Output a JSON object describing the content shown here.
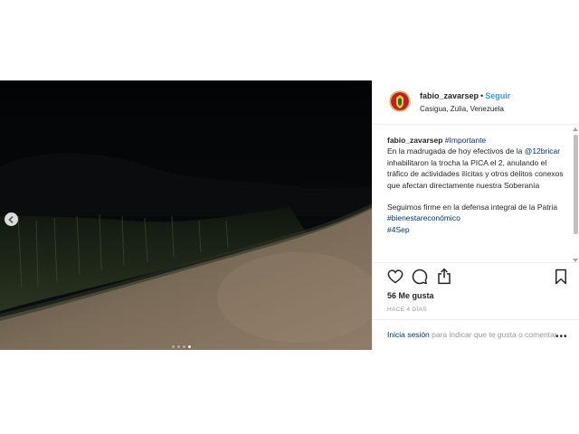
{
  "post": {
    "username": "fabio_zavarsep",
    "separator": "•",
    "follow_label": "Seguir",
    "location": "Casigua, Zulia, Venezuela",
    "caption": {
      "username": "fabio_zavarsep",
      "hashtag_top": "#Importante",
      "line1": "En la madrugada de hoy efectivos de la",
      "mention": "@12bricar",
      "line2_rest": " inhabilitaron la trocha la PICA el 2, anulando el tráfico de actividades ilícitas y otros delitos conexos que afectan directamente nuestra Soberanía",
      "paragraph2": "Seguimos firme en la defensa integral de la Patria",
      "hashtag1": "#bienestareconómico",
      "hashtag2": "#4Sep"
    },
    "likes": "56 Me gusta",
    "time_ago": "HACE 4 DÍAS",
    "login_link": "Inicia sesión",
    "login_rest": " para indicar que te gusta o comentar.",
    "more_options": "•••"
  },
  "carousel": {
    "slides": 4,
    "active_index": 3
  },
  "icons": {
    "prev": "chevron-left-icon",
    "like": "heart-icon",
    "comment": "comment-icon",
    "share": "share-icon",
    "save": "bookmark-icon"
  },
  "colors": {
    "link": "#003569",
    "follow": "#3897f0",
    "muted": "#999999"
  }
}
